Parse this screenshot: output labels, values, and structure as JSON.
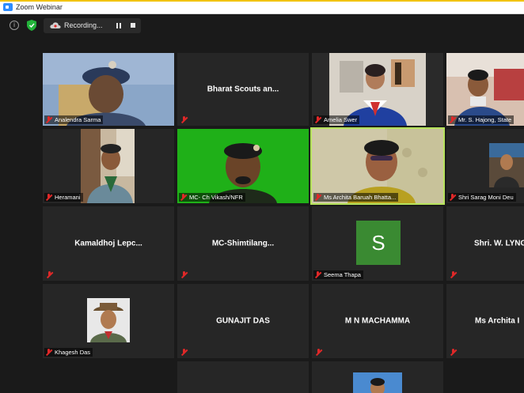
{
  "window": {
    "title": "Zoom Webinar"
  },
  "toolbar": {
    "recording_label": "Recording..."
  },
  "participants": [
    {
      "name": "Analendra Sarma"
    },
    {
      "name": "Bharat Scouts an..."
    },
    {
      "name": "Amelia Swer"
    },
    {
      "name": "Mr. S. Hajong, State"
    },
    {
      "name": "Heramani"
    },
    {
      "name": "MC- Ch Vikash/NFR"
    },
    {
      "name": "Ms Archita Baruah Bhatta..."
    },
    {
      "name": "Shri Sarag Moni Deu"
    },
    {
      "name": "Kamaldhoj Lepc..."
    },
    {
      "name": "MC-Shimtilang..."
    },
    {
      "name": "Seema Thapa",
      "initial": "S"
    },
    {
      "name": "Shri. W. LYNG"
    },
    {
      "name": "Khagesh Das"
    },
    {
      "name": "GUNAJIT DAS"
    },
    {
      "name": "M N MACHAMMA"
    },
    {
      "name": "Ms Archita I"
    }
  ],
  "colors": {
    "tile_bg": "#262626",
    "active_border": "#b6e35c",
    "mic_muted": "#e02828",
    "avatar_green": "#3a8a32"
  }
}
